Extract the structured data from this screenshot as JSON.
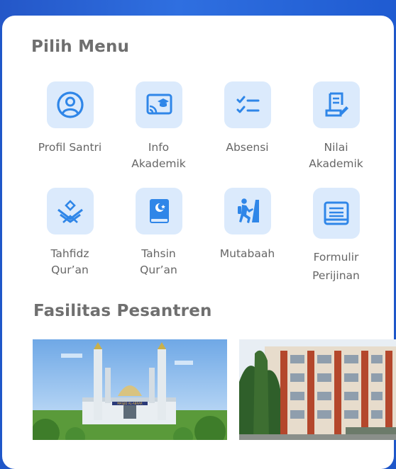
{
  "menu": {
    "title": "Pilih Menu",
    "items": [
      {
        "label": "Profil Santri",
        "icon": "user-circle-icon"
      },
      {
        "label": "Info\nAkademik",
        "icon": "academic-broadcast-icon"
      },
      {
        "label": "Absensi",
        "icon": "checklist-icon"
      },
      {
        "label": "Nilai\nAkademik",
        "icon": "grade-document-icon"
      },
      {
        "label": "Tahfidz\nQur’an",
        "icon": "open-quran-icon"
      },
      {
        "label": "Tahsin\nQur’an",
        "icon": "quran-book-icon"
      },
      {
        "label": "Mutabaah",
        "icon": "climbing-icon"
      },
      {
        "label": "Formulir\nPerijinan",
        "icon": "form-book-icon"
      }
    ]
  },
  "facilities": {
    "title": "Fasilitas Pesantren",
    "photos": [
      {
        "caption_sign": "MASJID AL-ABRAR",
        "subject": "mosque"
      },
      {
        "subject": "dormitory building"
      }
    ]
  },
  "colors": {
    "accent": "#2f86e8",
    "icon_bg": "#dbeafc",
    "header_blue": "#1f57c9",
    "text_gray": "#666666"
  }
}
